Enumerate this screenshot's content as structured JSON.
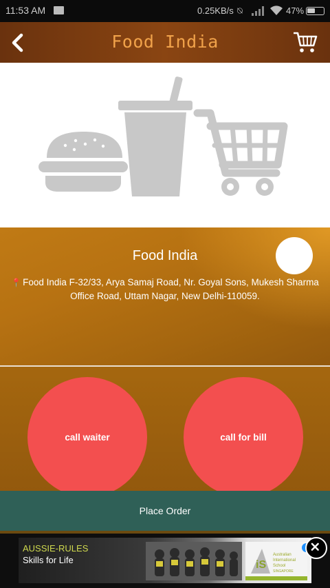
{
  "status_bar": {
    "time": "11:53 AM",
    "speed": "0.25KB/s",
    "battery": "47%"
  },
  "toolbar": {
    "title": "Food India"
  },
  "restaurant": {
    "name": "Food India",
    "address": "Food India F-32/33, Arya Samaj Road, Nr. Goyal Sons, Mukesh Sharma Office Road, Uttam Nagar, New Delhi-110059."
  },
  "actions": {
    "call_waiter": "call waiter",
    "call_bill": "call for bill",
    "place_order": "Place Order"
  },
  "ad": {
    "headline": "AUSSIE-RULES",
    "subline": "Skills for Life",
    "logo_text": "Australian International School SINGAPORE"
  },
  "colors": {
    "toolbar_title": "#f0a24a",
    "round_button": "#f34f4f",
    "place_order_bg": "#2f6057",
    "banner_icons": "#c8c8c8"
  },
  "icons": {
    "back": "chevron-left-icon",
    "cart": "cart-icon",
    "pin": "map-pin-icon"
  }
}
